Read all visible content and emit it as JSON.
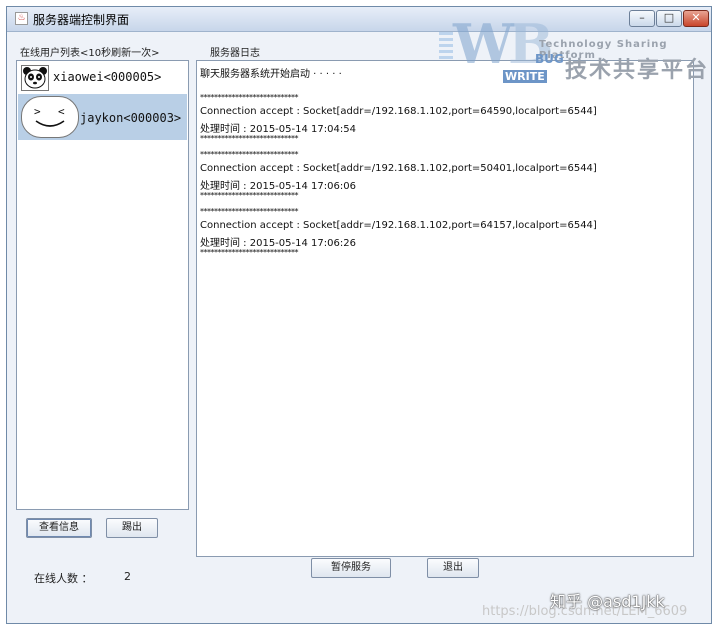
{
  "window": {
    "title": "服务器端控制界面",
    "controls": {
      "minimize": "–",
      "maximize": "□",
      "close": "✕"
    }
  },
  "labels": {
    "user_list": "在线用户列表<10秒刷新一次>",
    "server_log": "服务器日志",
    "online_count_label": "在线人数 ："
  },
  "online_count": "2",
  "users": [
    {
      "name": "xiaowei<000005>",
      "avatar": "panda-avatar"
    },
    {
      "name": "jaykon<000003>",
      "avatar": "smiley-bubble-avatar",
      "selected": true
    }
  ],
  "log_lines": [
    "聊天服务器系统开始启动 · · · · ·",
    "****************************",
    "Connection accept : Socket[addr=/192.168.1.102,port=64590,localport=6544]",
    "处理时间 : 2015-05-14 17:04:54",
    "****************************",
    "****************************",
    "Connection accept : Socket[addr=/192.168.1.102,port=50401,localport=6544]",
    "处理时间 : 2015-05-14 17:06:06",
    "****************************",
    "****************************",
    "Connection accept : Socket[addr=/192.168.1.102,port=64157,localport=6544]",
    "处理时间 : 2015-05-14 17:06:26",
    "****************************"
  ],
  "buttons": {
    "view_info": "查看信息",
    "left_exit": "踢出",
    "pause_service": "暂停服务",
    "exit": "退出"
  },
  "watermark": {
    "bug": "BUG",
    "write": "WRITE",
    "tagline": "Technology Sharing Platform",
    "cn": "技术共享平台"
  },
  "overlay": {
    "zhihu": "知乎 @asd1Jkk",
    "csdn": "https://blog.csdn.net/LEM_6609"
  }
}
